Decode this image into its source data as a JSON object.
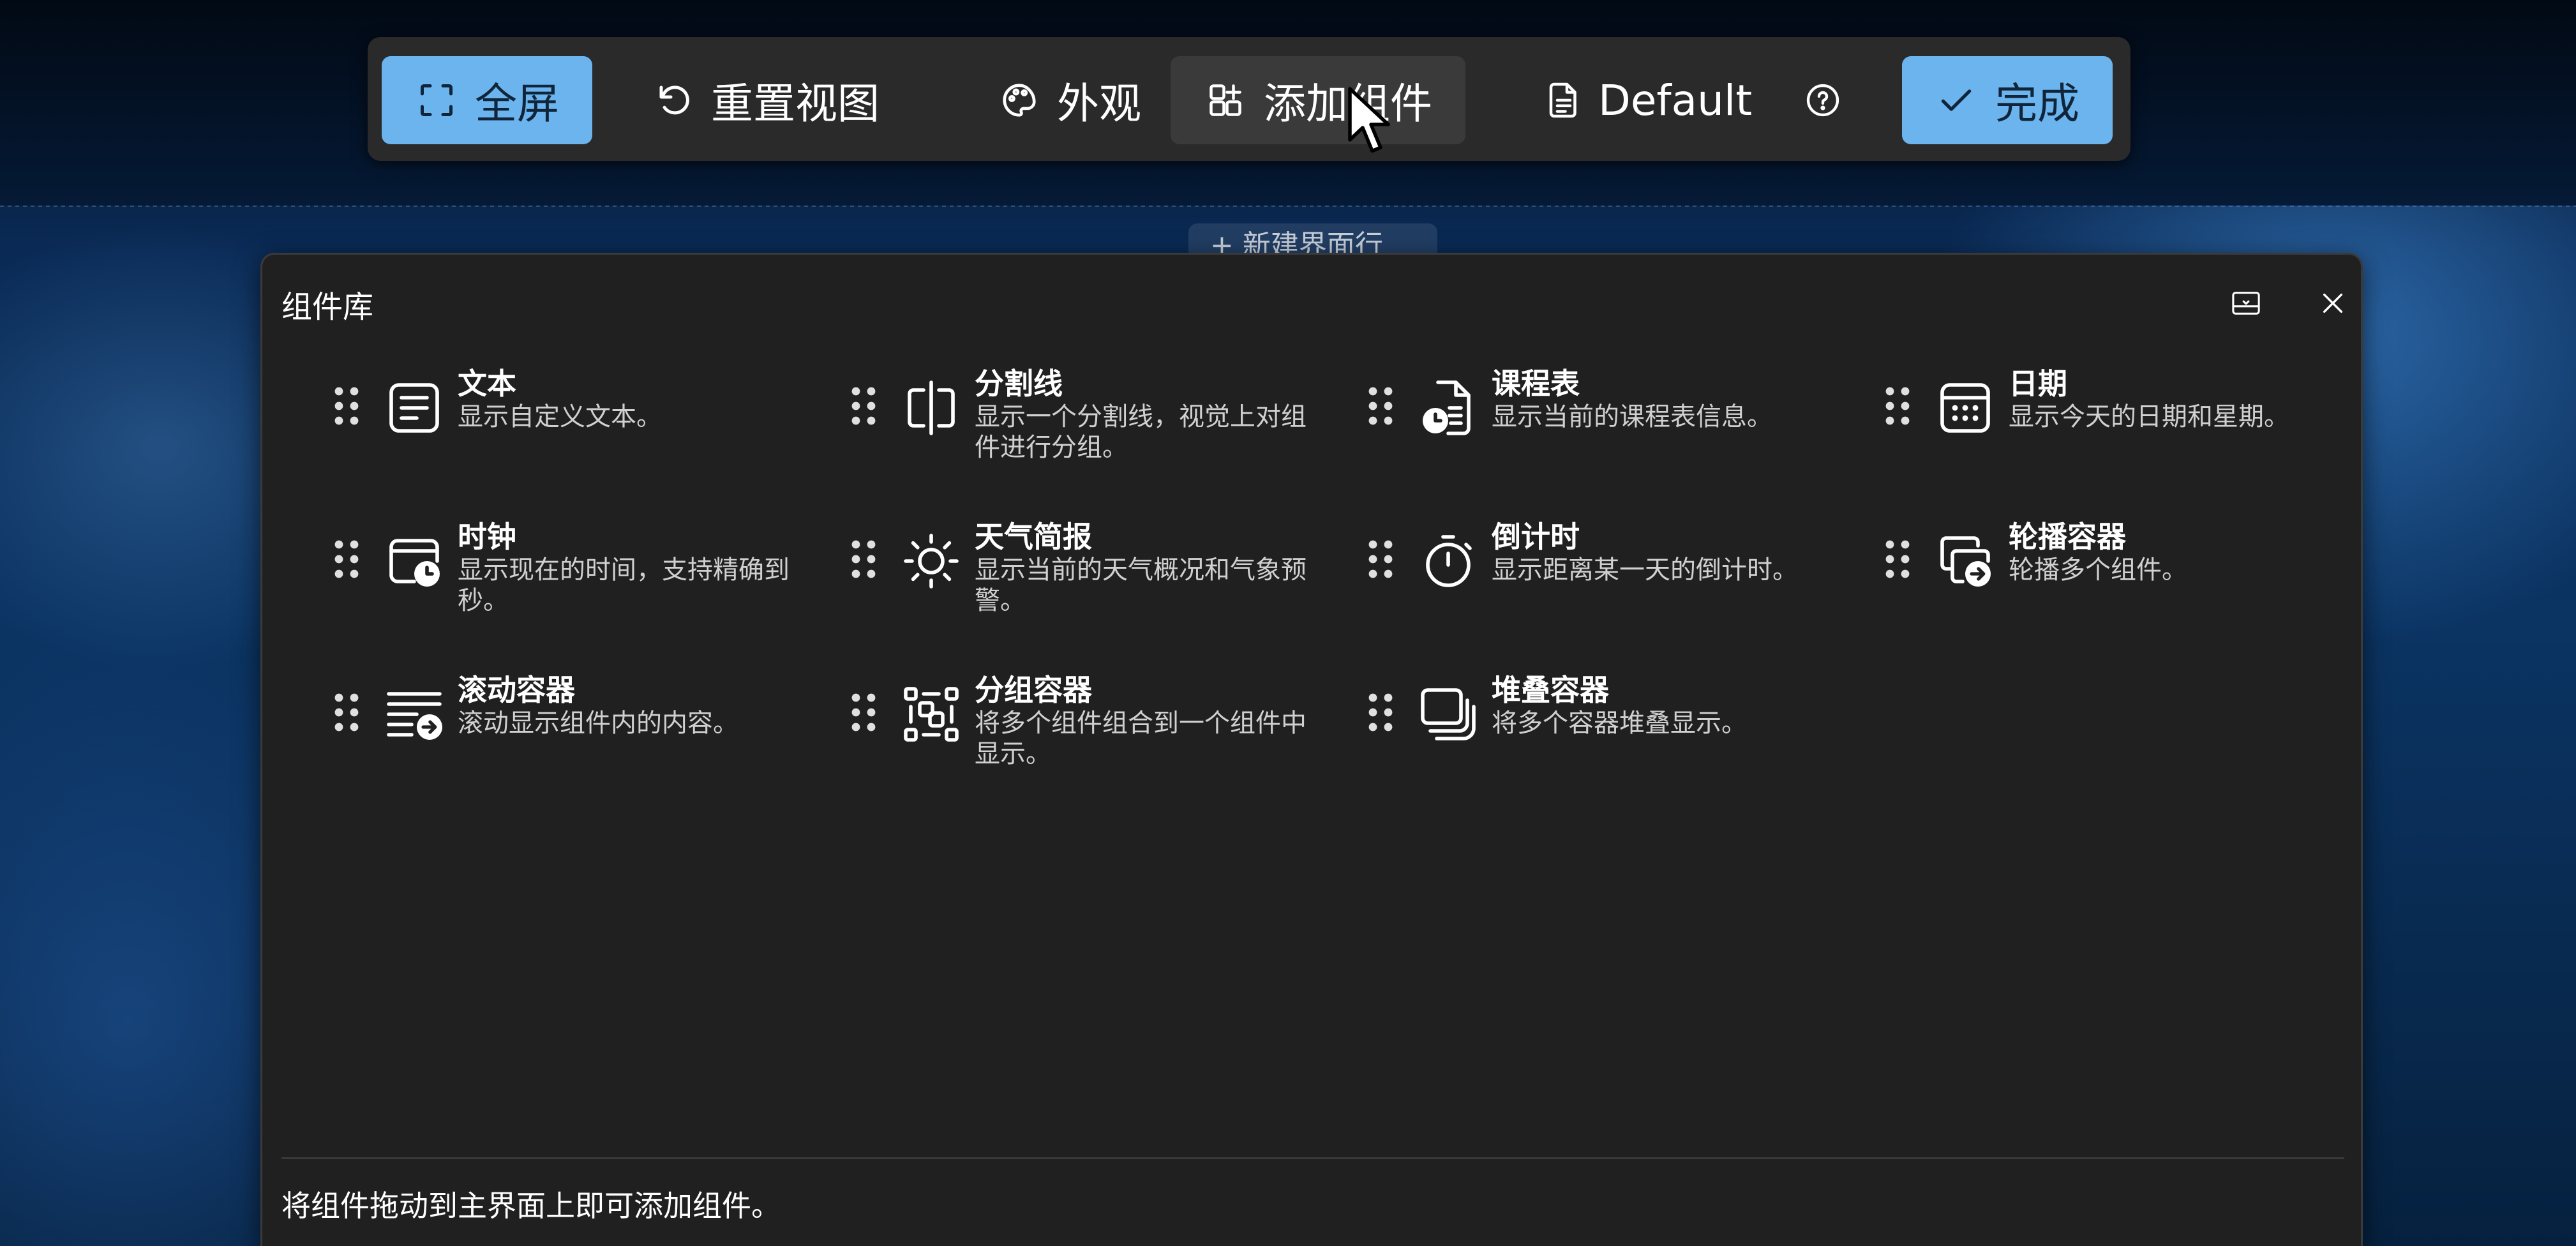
{
  "background": {
    "ghost_row_label": "+ 新建界面行"
  },
  "toolbar": {
    "fullscreen_label": "全屏",
    "reset_view_label": "重置视图",
    "appearance_label": "外观",
    "add_widget_label": "添加组件",
    "profile_label": "Default",
    "done_label": "完成",
    "accent_color": "#6cb4ee",
    "icons": {
      "fullscreen": "fullscreen-icon",
      "reset_view": "undo-icon",
      "appearance": "palette-icon",
      "add_widget": "add-widget-icon",
      "profile": "document-icon",
      "help": "help-icon",
      "done": "checkmark-icon"
    }
  },
  "panel": {
    "title": "组件库",
    "dock_icon": "dock-panel-icon",
    "close_icon": "close-icon",
    "footer_hint": "将组件拖动到主界面上即可添加组件。",
    "items": [
      {
        "title": "文本",
        "desc": "显示自定义文本。",
        "icon": "text-icon"
      },
      {
        "title": "分割线",
        "desc": "显示一个分割线，视觉上对组件进行分组。",
        "icon": "divider-icon"
      },
      {
        "title": "课程表",
        "desc": "显示当前的课程表信息。",
        "icon": "schedule-icon"
      },
      {
        "title": "日期",
        "desc": "显示今天的日期和星期。",
        "icon": "calendar-icon"
      },
      {
        "title": "时钟",
        "desc": "显示现在的时间，支持精确到秒。",
        "icon": "clock-icon"
      },
      {
        "title": "天气简报",
        "desc": "显示当前的天气概况和气象预警。",
        "icon": "weather-sun-icon"
      },
      {
        "title": "倒计时",
        "desc": "显示距离某一天的倒计时。",
        "icon": "timer-icon"
      },
      {
        "title": "轮播容器",
        "desc": "轮播多个组件。",
        "icon": "carousel-container-icon"
      },
      {
        "title": "滚动容器",
        "desc": "滚动显示组件内的内容。",
        "icon": "scroll-container-icon"
      },
      {
        "title": "分组容器",
        "desc": "将多个组件组合到一个组件中显示。",
        "icon": "group-container-icon"
      },
      {
        "title": "堆叠容器",
        "desc": "将多个容器堆叠显示。",
        "icon": "stack-container-icon"
      }
    ]
  }
}
